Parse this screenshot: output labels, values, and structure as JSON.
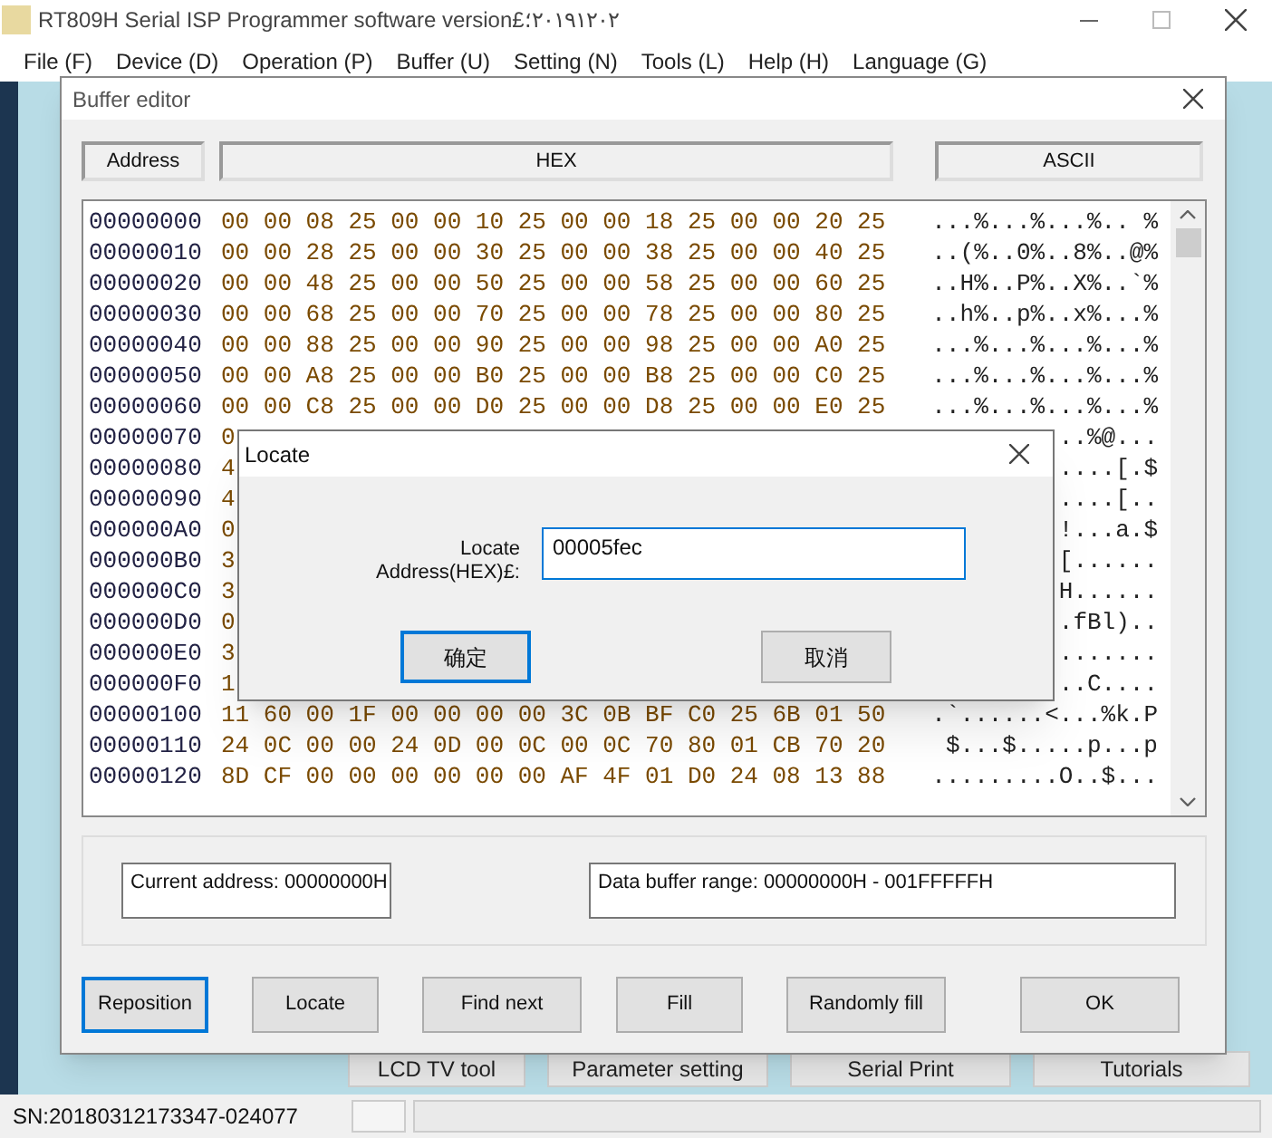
{
  "app_window": {
    "title": "RT809H Serial ISP Programmer software version£٢٠١٩١٢٠٢؛",
    "menu": [
      "File (F)",
      "Device (D)",
      "Operation (P)",
      "Buffer (U)",
      "Setting (N)",
      "Tools (L)",
      "Help (H)",
      "Language (G)"
    ],
    "tool_tabs": [
      "LCD TV tool",
      "Parameter setting",
      "Serial Print",
      "Tutorials"
    ],
    "status_bar": {
      "serial": "SN:20180312173347-024077"
    }
  },
  "buffer_editor": {
    "title": "Buffer editor",
    "headers": [
      "Address",
      "HEX",
      "ASCII"
    ],
    "rows": [
      {
        "address": "00000000",
        "hex": "00 00 08 25 00 00 10 25 00 00 18 25 00 00 20 25",
        "ascii": "...%...%...%.. %"
      },
      {
        "address": "00000010",
        "hex": "00 00 28 25 00 00 30 25 00 00 38 25 00 00 40 25",
        "ascii": "..(%..0%..8%..@%"
      },
      {
        "address": "00000020",
        "hex": "00 00 48 25 00 00 50 25 00 00 58 25 00 00 60 25",
        "ascii": "..H%..P%..X%..`%"
      },
      {
        "address": "00000030",
        "hex": "00 00 68 25 00 00 70 25 00 00 78 25 00 00 80 25",
        "ascii": "..h%..p%..x%...%"
      },
      {
        "address": "00000040",
        "hex": "00 00 88 25 00 00 90 25 00 00 98 25 00 00 A0 25",
        "ascii": "...%...%...%...%"
      },
      {
        "address": "00000050",
        "hex": "00 00 A8 25 00 00 B0 25 00 00 B8 25 00 00 C0 25",
        "ascii": "...%...%...%...%"
      },
      {
        "address": "00000060",
        "hex": "00 00 C8 25 00 00 D0 25 00 00 D8 25 00 00 E0 25",
        "ascii": "...%...%...%...%"
      },
      {
        "address": "00000070",
        "hex": "0",
        "ascii": "..%@..."
      },
      {
        "address": "00000080",
        "hex": "4",
        "ascii": "....[.$"
      },
      {
        "address": "00000090",
        "hex": "4",
        "ascii": "....[.."
      },
      {
        "address": "000000A0",
        "hex": "0",
        "ascii": "!...a.$"
      },
      {
        "address": "000000B0",
        "hex": "3",
        "ascii": "[......"
      },
      {
        "address": "000000C0",
        "hex": "3",
        "ascii": "H......"
      },
      {
        "address": "000000D0",
        "hex": "0",
        "ascii": ".fBl).."
      },
      {
        "address": "000000E0",
        "hex": "3",
        "ascii": "......."
      },
      {
        "address": "000000F0",
        "hex": "1",
        "ascii": "..C...."
      },
      {
        "address": "00000100",
        "hex": "11 60 00 1F 00 00 00 00 3C 0B BF C0 25 6B 01 50",
        "ascii": ".`......<...%k.P"
      },
      {
        "address": "00000110",
        "hex": "24 0C 00 00 24 0D 00 0C 00 0C 70 80 01 CB 70 20",
        "ascii": "$...$.....p...p"
      },
      {
        "address": "00000120",
        "hex": "8D CF 00 00 00 00 00 00 AF 4F 01 D0 24 08 13 88",
        "ascii": ".........O..$..."
      }
    ],
    "current_address": "Current address: 00000000H",
    "buffer_range": "Data buffer range: 00000000H - 001FFFFFH",
    "buttons": [
      {
        "label": "Reposition",
        "focused": true
      },
      {
        "label": "Locate",
        "focused": false
      },
      {
        "label": "Find next",
        "focused": false
      },
      {
        "label": "Fill",
        "focused": false
      },
      {
        "label": "Randomly fill",
        "focused": false
      },
      {
        "label": "OK",
        "focused": false
      }
    ]
  },
  "locate_dialog": {
    "title": "Locate",
    "label_lines": [
      "Locate",
      "Address(HEX)£:"
    ],
    "value": "00005fec",
    "buttons": [
      {
        "label": "确定",
        "focused": true
      },
      {
        "label": "取消",
        "focused": false
      }
    ]
  }
}
